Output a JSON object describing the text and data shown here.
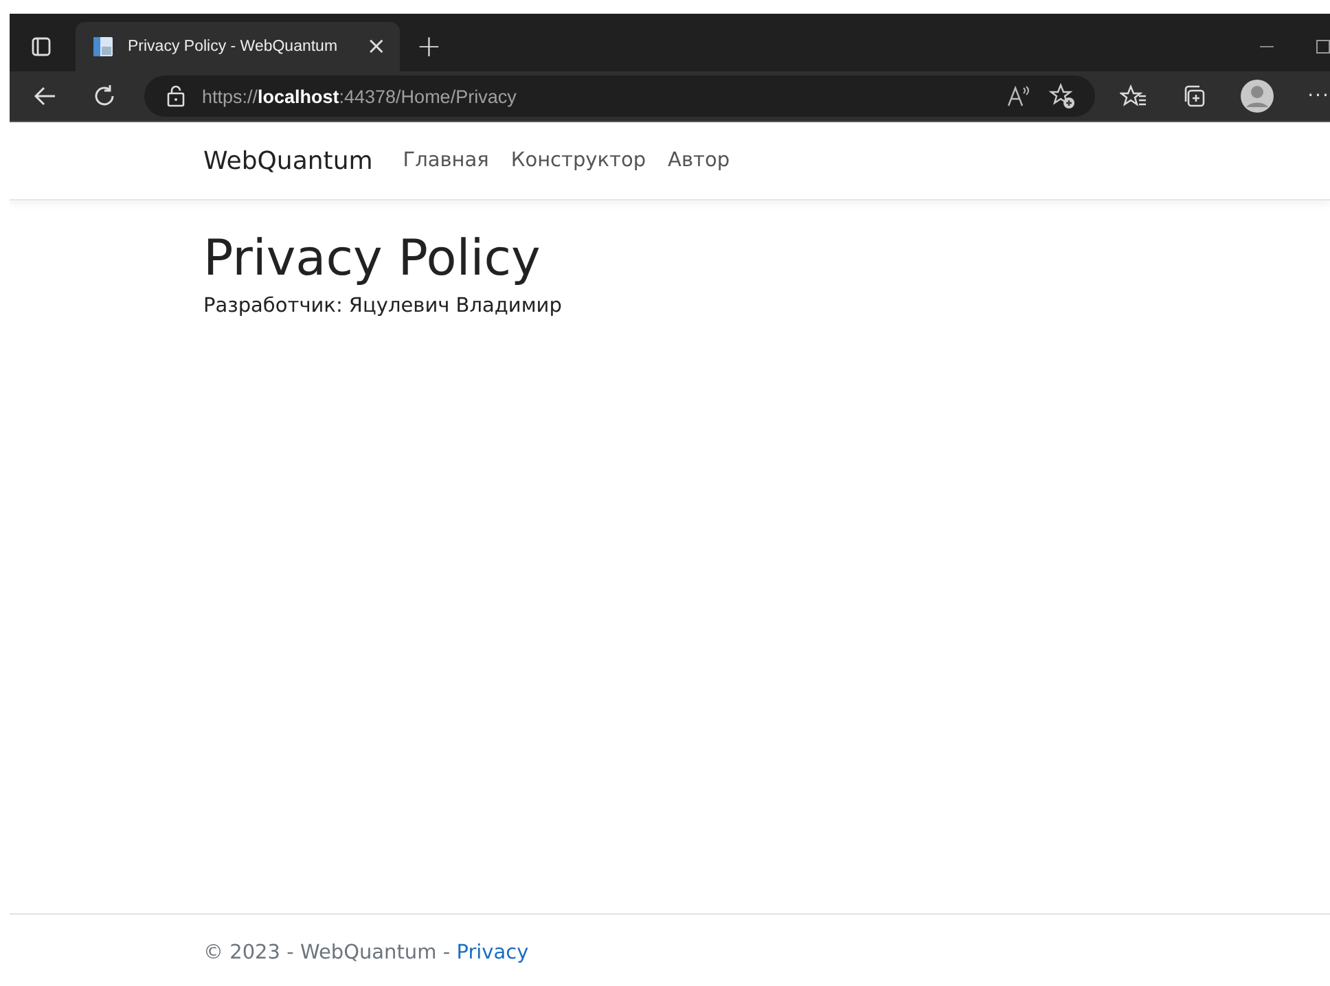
{
  "browser": {
    "tab": {
      "title": "Privacy Policy - WebQuantum",
      "close": "×"
    },
    "new_tab": "+",
    "url": {
      "scheme": "https://",
      "host": "localhost",
      "path": ":44378/Home/Privacy"
    },
    "more": "···"
  },
  "navbar": {
    "brand": "WebQuantum",
    "links": [
      "Главная",
      "Конструктор",
      "Автор"
    ]
  },
  "main": {
    "heading": "Privacy Policy",
    "text": "Разработчик: Яцулевич Владимир"
  },
  "footer": {
    "text": "© 2023 - WebQuantum - ",
    "link": "Privacy"
  }
}
